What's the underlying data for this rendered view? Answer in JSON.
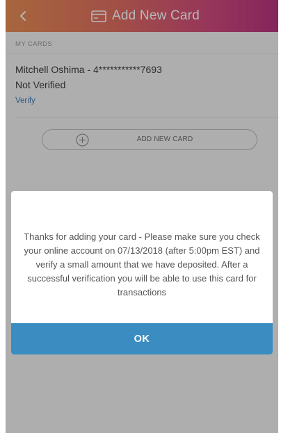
{
  "header": {
    "title": "Add New Card",
    "back_icon": "chevron-left-icon",
    "title_icon": "credit-card-icon"
  },
  "cards_section": {
    "label": "MY CARDS",
    "card": {
      "name": "Mitchell Oshima - 4***********7693",
      "status": "Not Verified",
      "verify_label": "Verify"
    }
  },
  "add_card_button": {
    "label": "ADD NEW CARD",
    "icon": "plus-circle-icon"
  },
  "dialog": {
    "message": "Thanks for adding your card - Please make sure you check your online account on 07/13/2018 (after 5:00pm EST) and verify a small amount that we have deposited. After a successful verification you will be able to use this card for transactions",
    "ok_label": "OK"
  },
  "colors": {
    "header_gradient_start": "#e88e55",
    "header_gradient_end": "#b8347f",
    "link": "#3e7fb6",
    "ok_button": "#3a8cc1"
  }
}
